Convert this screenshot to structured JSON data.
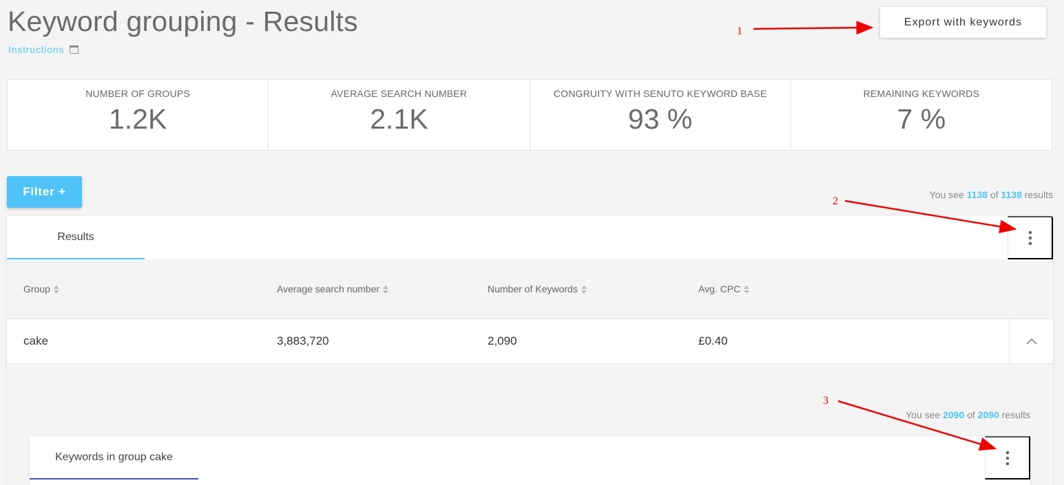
{
  "header": {
    "title": "Keyword grouping - Results",
    "instructions_label": "Instructions",
    "export_label": "Export with keywords"
  },
  "stats": [
    {
      "label": "NUMBER OF GROUPS",
      "value": "1.2K"
    },
    {
      "label": "AVERAGE SEARCH NUMBER",
      "value": "2.1K"
    },
    {
      "label": "CONGRUITY WITH SENUTO KEYWORD BASE",
      "value": "93 %"
    },
    {
      "label": "REMAINING KEYWORDS",
      "value": "7 %"
    }
  ],
  "filter": {
    "label": "Filter +"
  },
  "results_count": {
    "prefix": "You see",
    "shown": "1138",
    "middle": "of",
    "total": "1138",
    "suffix": "results"
  },
  "results_card": {
    "tab_label": "Results",
    "columns": [
      "Group",
      "Average search number",
      "Number of Keywords",
      "Avg. CPC"
    ],
    "rows": [
      {
        "group": "cake",
        "avg_search": "3,883,720",
        "num_keywords": "2,090",
        "avg_cpc": "£0.40"
      }
    ]
  },
  "group_detail": {
    "count": {
      "prefix": "You see",
      "shown": "2090",
      "middle": "of",
      "total": "2090",
      "suffix": "results"
    },
    "tab_label": "Keywords in group cake"
  },
  "annotations": [
    "1",
    "2",
    "3"
  ],
  "colors": {
    "accent": "#4fc3f7",
    "annotation": "#ee0000",
    "tab_underline_secondary": "#3f51b5"
  }
}
